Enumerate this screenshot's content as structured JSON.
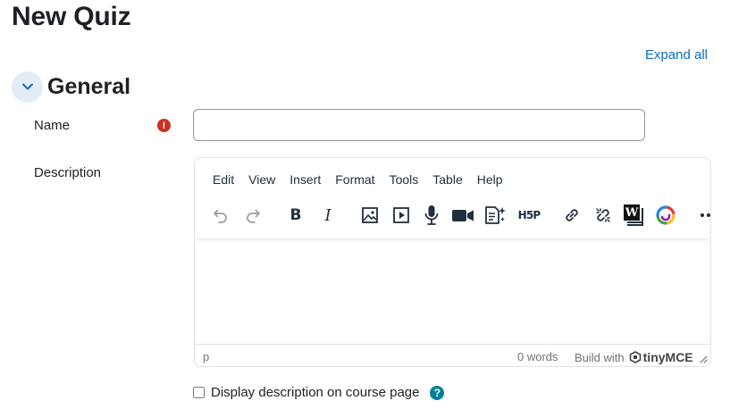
{
  "page": {
    "title": "New Quiz",
    "expand_all": "Expand all"
  },
  "section": {
    "title": "General"
  },
  "form": {
    "name_label": "Name",
    "name_value": "",
    "description_label": "Description",
    "display_description_label": "Display description on course page"
  },
  "editor": {
    "menu": [
      "Edit",
      "View",
      "Insert",
      "Format",
      "Tools",
      "Table",
      "Help"
    ],
    "toolbar_icons": [
      "undo-icon",
      "redo-icon",
      "bold-icon",
      "italic-icon",
      "image-icon",
      "media-icon",
      "record-audio-icon",
      "record-video-icon",
      "content-template-icon",
      "h5p-icon",
      "link-icon",
      "unlink-icon",
      "word-import-icon",
      "color-wheel-icon",
      "more-icon"
    ],
    "bold_glyph": "B",
    "italic_glyph": "I",
    "h5p_glyph": "H5P",
    "word_glyph": "W",
    "status_path": "p",
    "word_count": "0 words",
    "build_with": "Build with",
    "brand": "tinyMCE"
  },
  "colors": {
    "link": "#0f6cbf",
    "required": "#ca3120",
    "help": "#008196",
    "collapse_bg": "#e4ecf5"
  }
}
